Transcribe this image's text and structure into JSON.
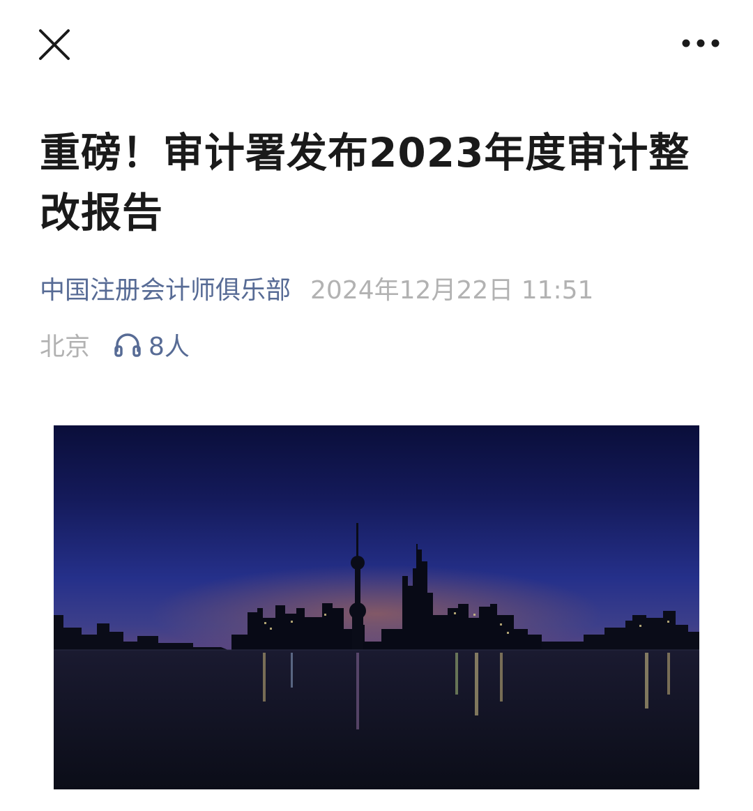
{
  "topbar": {
    "close_icon": "close-icon",
    "more_icon": "more-icon"
  },
  "article": {
    "title": "重磅！审计署发布2023年度审计整改报告",
    "account_name": "中国注册会计师俱乐部",
    "datetime": "2024年12月22日 11:51",
    "location": "北京",
    "listen_icon": "headphones-icon",
    "listen_count": "8人"
  },
  "hero_image": {
    "description_icon": "city-skyline-image"
  },
  "colors": {
    "link": "#576b95",
    "meta_gray": "#b2b2b2",
    "title": "#1a1a1a"
  }
}
